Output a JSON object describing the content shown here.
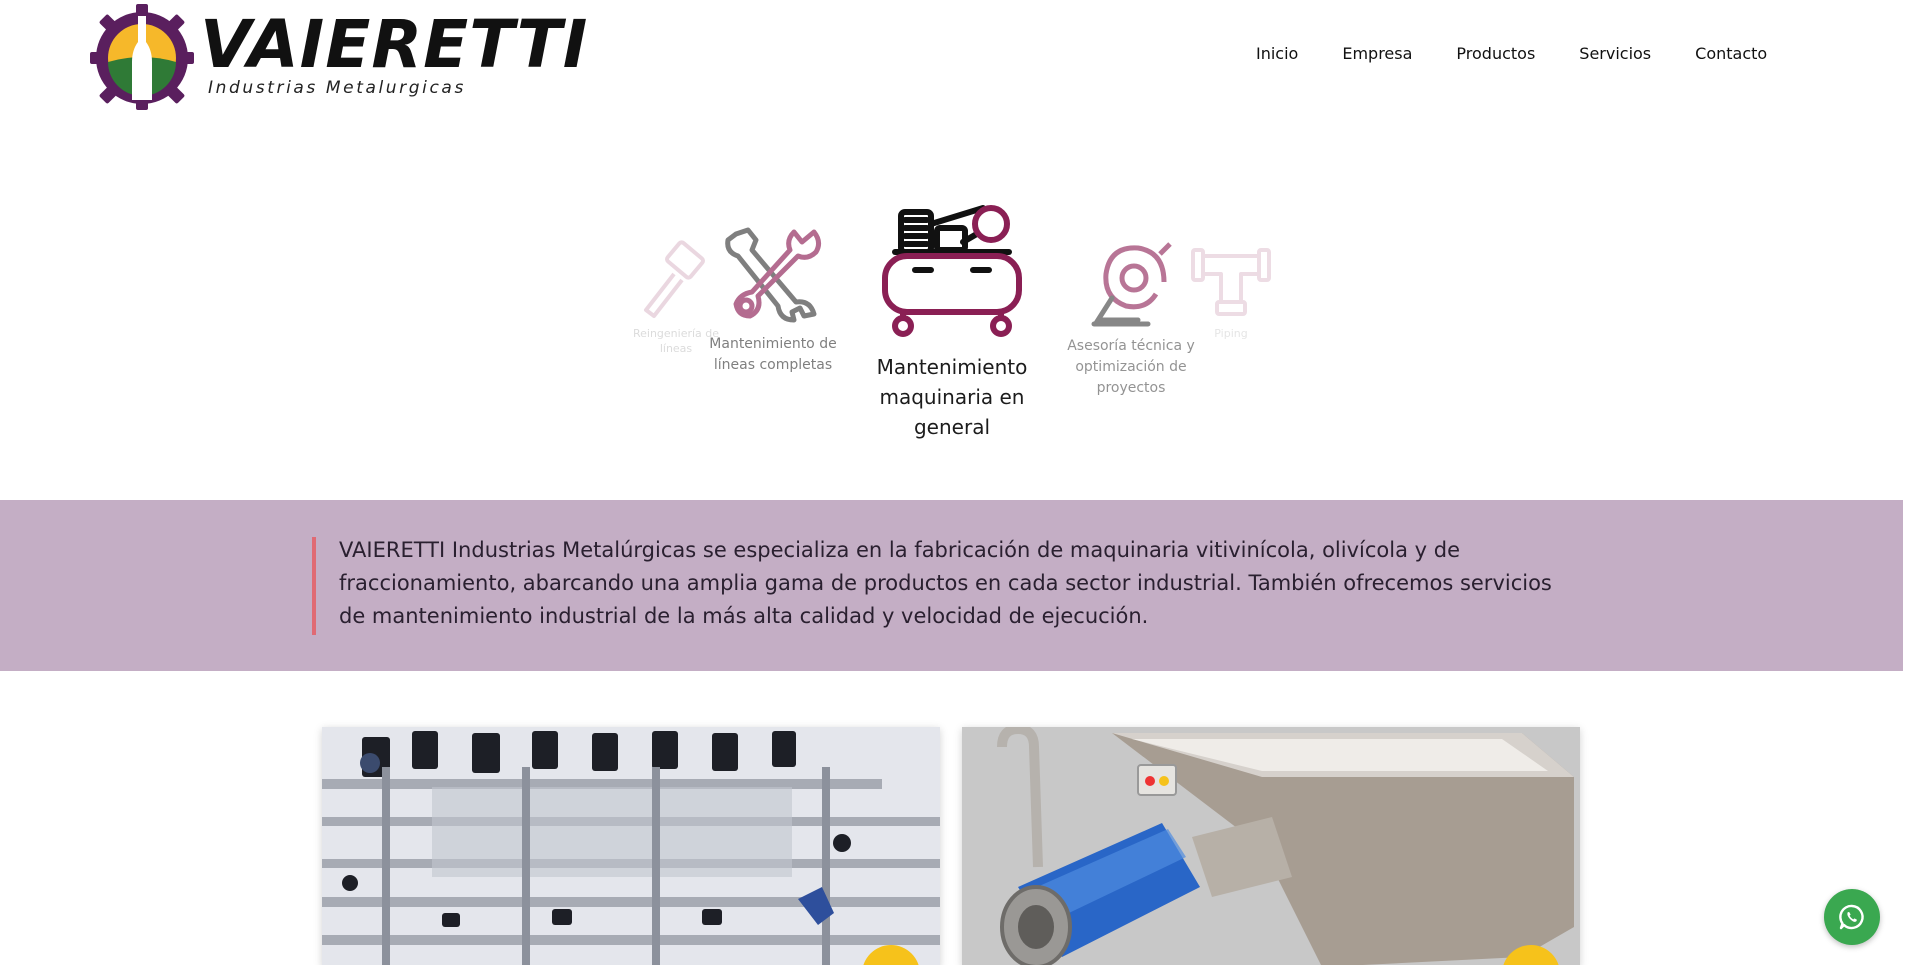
{
  "brand": {
    "name": "VAIERETTI",
    "tagline": "Industrias Metalurgicas"
  },
  "nav": {
    "items": [
      "Inicio",
      "Empresa",
      "Productos",
      "Servicios",
      "Contacto"
    ]
  },
  "services": {
    "items": [
      {
        "label": "Reingeniería de líneas",
        "icon": "hammer-icon"
      },
      {
        "label": "Mantenimiento de líneas completas",
        "icon": "wrench-icon"
      },
      {
        "label": "Mantenimiento maquinaria en general",
        "icon": "compressor-icon"
      },
      {
        "label": "Asesoría técnica y optimización de proyectos",
        "icon": "pump-icon"
      },
      {
        "label": "Piping",
        "icon": "pipe-fitting-icon"
      }
    ],
    "active_index": 2
  },
  "about": {
    "text": "VAIERETTI Industrias Metalúrgicas se especializa en la fabricación de maquinaria vitivinícola, olivícola y de fraccionamiento, abarcando una amplia gama de productos en cada sector industrial. También ofrecemos servicios de mantenimiento industrial de la más alta calidad y velocidad de ejecución."
  },
  "colors": {
    "band": "#c4aec5",
    "accent_bar": "#e06a74",
    "brand_purple": "#5a1f5e",
    "brand_yellow": "#f6b82a",
    "brand_green": "#2f7a36",
    "whatsapp": "#3aa850",
    "badge": "#f6c21b"
  },
  "floating": {
    "icon": "whatsapp-icon"
  }
}
